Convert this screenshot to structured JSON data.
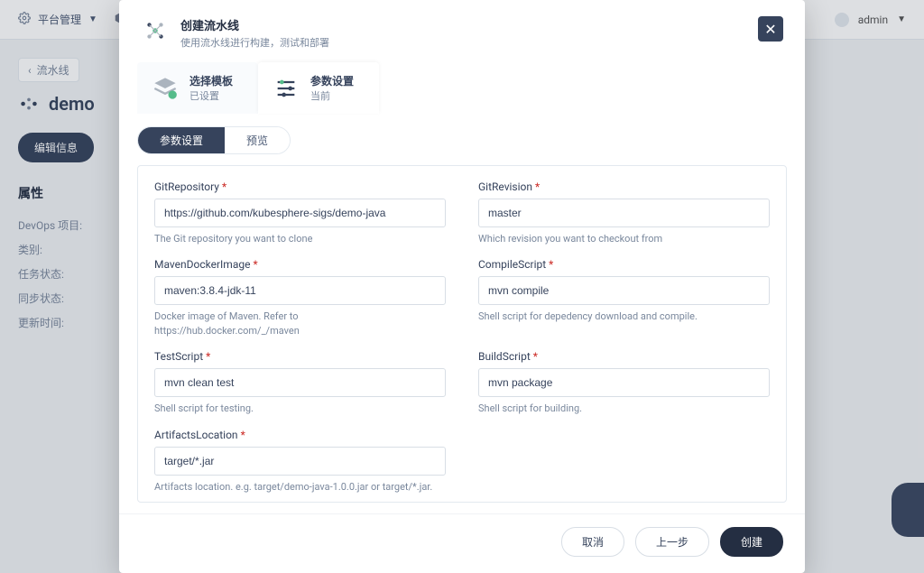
{
  "header": {
    "platform_label": "平台管理",
    "user_label": "admin"
  },
  "bg_page": {
    "breadcrumb": "流水线",
    "title": "demo",
    "edit_btn": "编辑信息",
    "props_title": "属性",
    "props": [
      "DevOps 项目:",
      "类别:",
      "任务状态:",
      "同步状态:",
      "更新时间:"
    ]
  },
  "modal": {
    "title": "创建流水线",
    "subtitle": "使用流水线进行构建，测试和部署",
    "steps": [
      {
        "title": "选择模板",
        "sub": "已设置"
      },
      {
        "title": "参数设置",
        "sub": "当前"
      }
    ],
    "tabs": {
      "params": "参数设置",
      "preview": "预览"
    },
    "fields": {
      "git_repo": {
        "label": "GitRepository",
        "value": "https://github.com/kubesphere-sigs/demo-java",
        "help": "The Git repository you want to clone"
      },
      "git_rev": {
        "label": "GitRevision",
        "value": "master",
        "help": "Which revision you want to checkout from"
      },
      "maven_img": {
        "label": "MavenDockerImage",
        "value": "maven:3.8.4-jdk-11",
        "help": "Docker image of Maven. Refer to https://hub.docker.com/_/maven"
      },
      "compile": {
        "label": "CompileScript",
        "value": "mvn compile",
        "help": "Shell script for depedency download and compile."
      },
      "test": {
        "label": "TestScript",
        "value": "mvn clean test",
        "help": "Shell script for testing."
      },
      "build": {
        "label": "BuildScript",
        "value": "mvn package",
        "help": "Shell script for building."
      },
      "artifacts": {
        "label": "ArtifactsLocation",
        "value": "target/*.jar",
        "help": "Artifacts location. e.g. target/demo-java-1.0.0.jar or target/*.jar."
      }
    },
    "footer": {
      "cancel": "取消",
      "prev": "上一步",
      "create": "创建"
    }
  }
}
